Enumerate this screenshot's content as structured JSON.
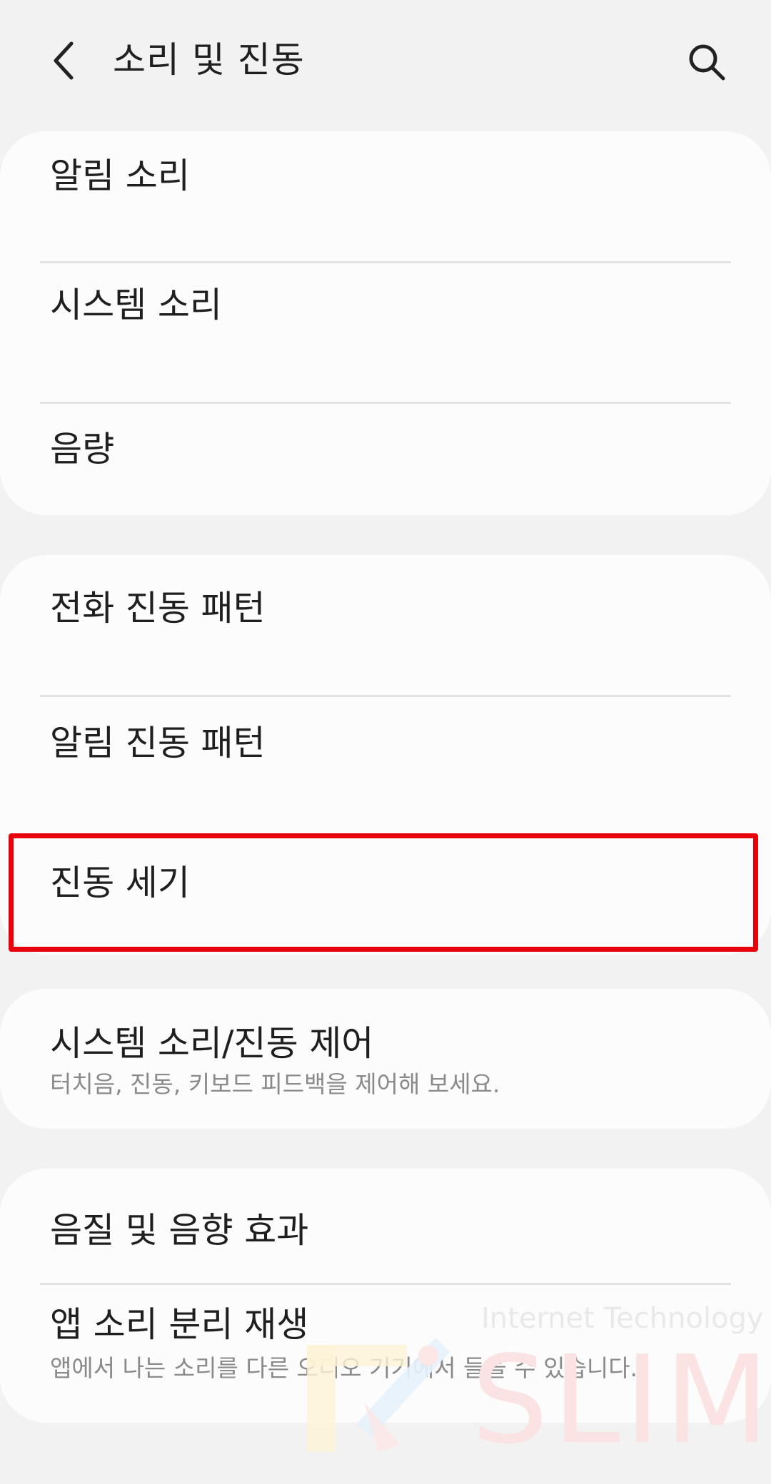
{
  "header": {
    "title": "소리 및 진동"
  },
  "cards": {
    "sound": {
      "items": [
        {
          "label": "알림 소리"
        },
        {
          "label": "시스템 소리"
        },
        {
          "label": "음량"
        }
      ]
    },
    "vibration": {
      "items": [
        {
          "label": "전화 진동 패턴"
        },
        {
          "label": "알림 진동 패턴"
        },
        {
          "label": "진동 세기"
        }
      ]
    },
    "control": {
      "items": [
        {
          "label": "시스템 소리/진동 제어",
          "sub": "터치음, 진동, 키보드 피드백을 제어해 보세요."
        }
      ]
    },
    "quality": {
      "items": [
        {
          "label": "음질 및 음향 효과"
        },
        {
          "label": "앱 소리 분리 재생",
          "sub": "앱에서 나는 소리를 다른 오디오 기기에서 들을 수 있습니다."
        }
      ]
    }
  },
  "highlight": {
    "color": "#e8000b",
    "target": "진동 세기"
  },
  "watermark": {
    "line1": "Internet Technology",
    "line2": "SLIM"
  },
  "icons": [
    "chevron-left-icon",
    "search-icon"
  ]
}
